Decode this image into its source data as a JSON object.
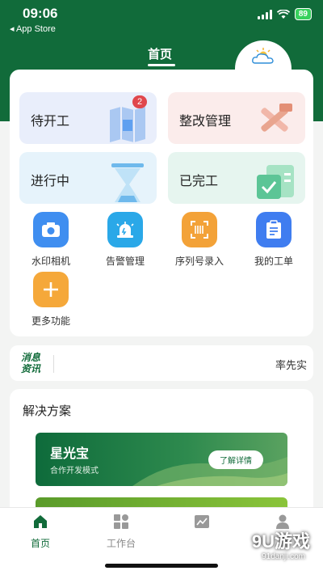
{
  "status": {
    "time": "09:06",
    "back_label": "◂ App Store",
    "battery": "89"
  },
  "header": {
    "title": "首页"
  },
  "weather": {
    "label": "多云"
  },
  "tiles": [
    {
      "label": "待开工",
      "badge": "2",
      "color": "#e9eefb"
    },
    {
      "label": "整改管理",
      "color": "#fbeceb"
    },
    {
      "label": "进行中",
      "color": "#e6f3fb"
    },
    {
      "label": "已完工",
      "color": "#e6f5ef"
    }
  ],
  "shortcuts": [
    {
      "label": "水印相机",
      "icon": "camera-icon",
      "color": "#3f8ef0"
    },
    {
      "label": "告警管理",
      "icon": "alarm-icon",
      "color": "#2aa8e8"
    },
    {
      "label": "序列号录入",
      "icon": "scan-icon",
      "color": "#f3a238"
    },
    {
      "label": "我的工单",
      "icon": "clipboard-icon",
      "color": "#3f7df0"
    },
    {
      "label": "更多功能",
      "icon": "plus-icon",
      "color": "#f5a83a"
    }
  ],
  "news": {
    "logo_line1": "消息",
    "logo_line2": "资讯",
    "ticker": "率先实"
  },
  "solutions": {
    "title": "解决方案",
    "banner": {
      "title": "星光宝",
      "subtitle": "合作开发模式",
      "button": "了解详情"
    }
  },
  "tabbar": [
    {
      "label": "首页",
      "icon": "home-icon",
      "active": true
    },
    {
      "label": "工作台",
      "icon": "grid-icon",
      "active": false
    },
    {
      "label": "",
      "icon": "chart-icon",
      "active": false
    },
    {
      "label": "",
      "icon": "user-icon",
      "active": false
    }
  ],
  "watermark": {
    "main": "9U游戏",
    "sub": "91danji.com"
  }
}
